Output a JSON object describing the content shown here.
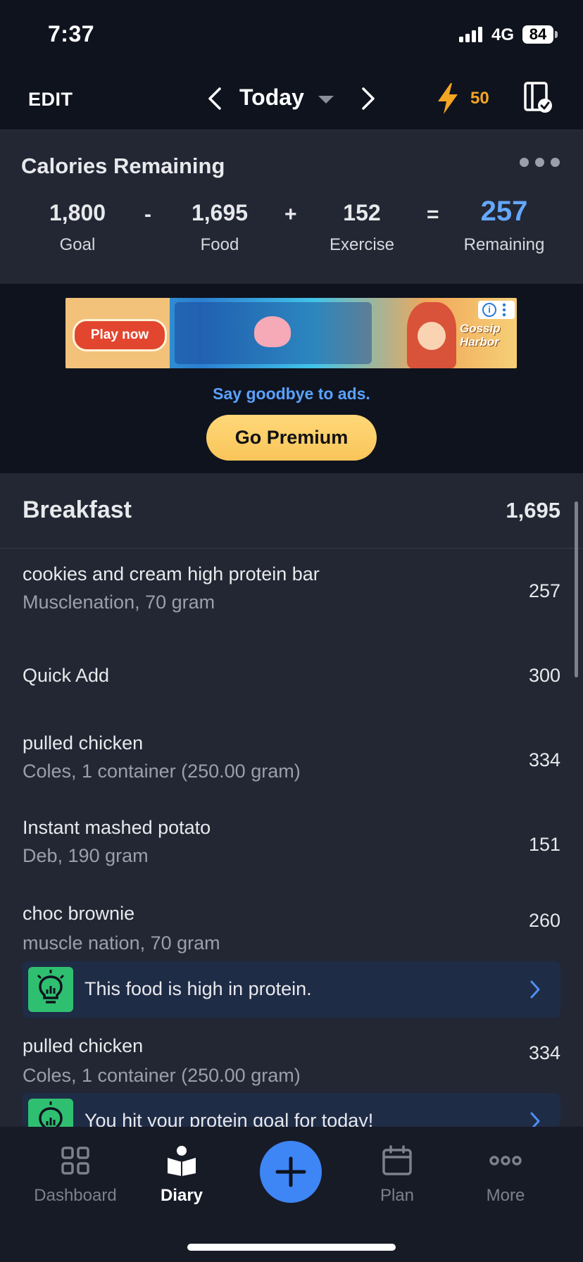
{
  "status_bar": {
    "time": "7:37",
    "network": "4G",
    "battery": "84"
  },
  "top_nav": {
    "edit_label": "EDIT",
    "date_label": "Today",
    "streak_count": "50"
  },
  "calories": {
    "title": "Calories Remaining",
    "goal": {
      "value": "1,800",
      "label": "Goal"
    },
    "op_minus": "-",
    "food": {
      "value": "1,695",
      "label": "Food"
    },
    "op_plus": "+",
    "exercise": {
      "value": "152",
      "label": "Exercise"
    },
    "op_equals": "=",
    "remaining": {
      "value": "257",
      "label": "Remaining"
    }
  },
  "ad": {
    "cta": "Play now",
    "logo_line1": "Gossip",
    "logo_line2": "Harbor"
  },
  "premium": {
    "tagline": "Say goodbye to ads.",
    "button_label": "Go Premium"
  },
  "meal": {
    "title": "Breakfast",
    "total": "1,695",
    "entries": [
      {
        "name": "cookies and cream high protein bar",
        "desc": "Musclenation, 70 gram",
        "calories": "257"
      },
      {
        "name": "Quick Add",
        "desc": "",
        "calories": "300"
      },
      {
        "name": "pulled chicken",
        "desc": "Coles, 1 container (250.00 gram)",
        "calories": "334"
      },
      {
        "name": "Instant mashed potato",
        "desc": "Deb, 190 gram",
        "calories": "151"
      },
      {
        "name": "choc brownie",
        "desc": "muscle nation, 70 gram",
        "calories": "260",
        "tip": "This food is high in protein."
      },
      {
        "name": "pulled chicken",
        "desc": "Coles, 1 container (250.00 gram)",
        "calories": "334",
        "tip": "You hit your protein goal for today!"
      }
    ]
  },
  "tab_bar": {
    "dashboard": "Dashboard",
    "diary": "Diary",
    "plan": "Plan",
    "more": "More"
  },
  "colors": {
    "accent_blue": "#3e86f5",
    "remaining_blue": "#64a8ff",
    "streak_orange": "#f5a524",
    "tip_green": "#2fbf71",
    "premium_gold": "#f9c55a"
  }
}
